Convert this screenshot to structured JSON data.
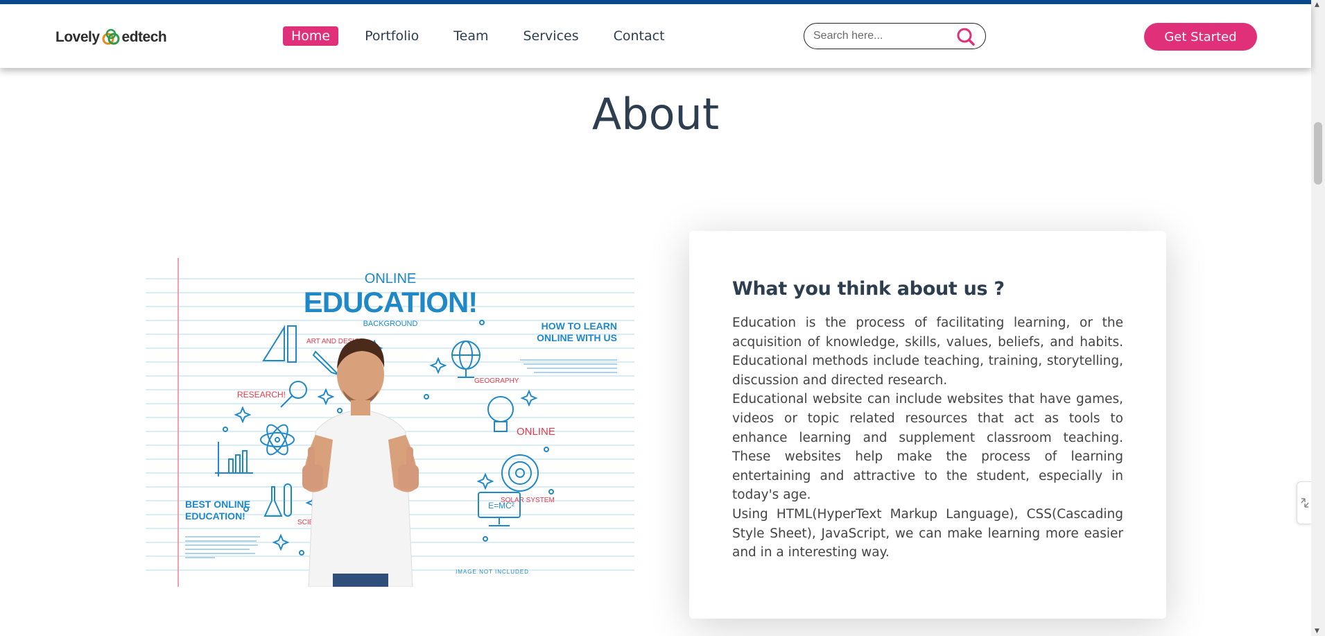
{
  "brand": {
    "logo_left": "Lovely",
    "logo_right": "edtech"
  },
  "nav": {
    "items": [
      {
        "label": "Home",
        "active": true
      },
      {
        "label": "Portfolio",
        "active": false
      },
      {
        "label": "Team",
        "active": false
      },
      {
        "label": "Services",
        "active": false
      },
      {
        "label": "Contact",
        "active": false
      }
    ]
  },
  "search": {
    "placeholder": "Search here..."
  },
  "cta": {
    "label": "Get Started"
  },
  "about": {
    "title": "About",
    "card": {
      "heading": "What you think about us ?",
      "paragraphs": [
        "Education is the process of facilitating learning, or the acquisition of knowledge, skills, values, beliefs, and habits. Educational methods include teaching, training, storytelling, discussion and directed research.",
        "Educational website can include websites that have games, videos or topic related resources that act as tools to enhance learning and supplement classroom teaching. These websites help make the process of learning entertaining and attractive to the student, especially in today's age.",
        "Using HTML(HyperText Markup Language), CSS(Cascading Style Sheet), JavaScript, we can make learning more easier and in a interesting way."
      ]
    },
    "illustration": {
      "online": "ONLINE",
      "education": "EDUCATION!",
      "background": "BACKGROUND",
      "how_to_learn_1": "HOW TO LEARN",
      "how_to_learn_2": "ONLINE WITH US",
      "art_design": "ART AND DESIGN",
      "research": "RESEARCH!",
      "geography": "GEOGRAPHY",
      "online_label": "ONLINE",
      "solar_system": "SOLAR SYSTEM",
      "science": "SCIENCE!",
      "best_online_1": "BEST ONLINE",
      "best_online_2": "EDUCATION!",
      "emc": "E=MC²",
      "image_not_included": "IMAGE NOT INCLUDED"
    }
  },
  "colors": {
    "accent": "#e0307a",
    "top_strip": "#0b4a8e",
    "title": "#2d3e50",
    "sketch_blue": "#1e88c8",
    "sketch_red": "#e8394a"
  }
}
